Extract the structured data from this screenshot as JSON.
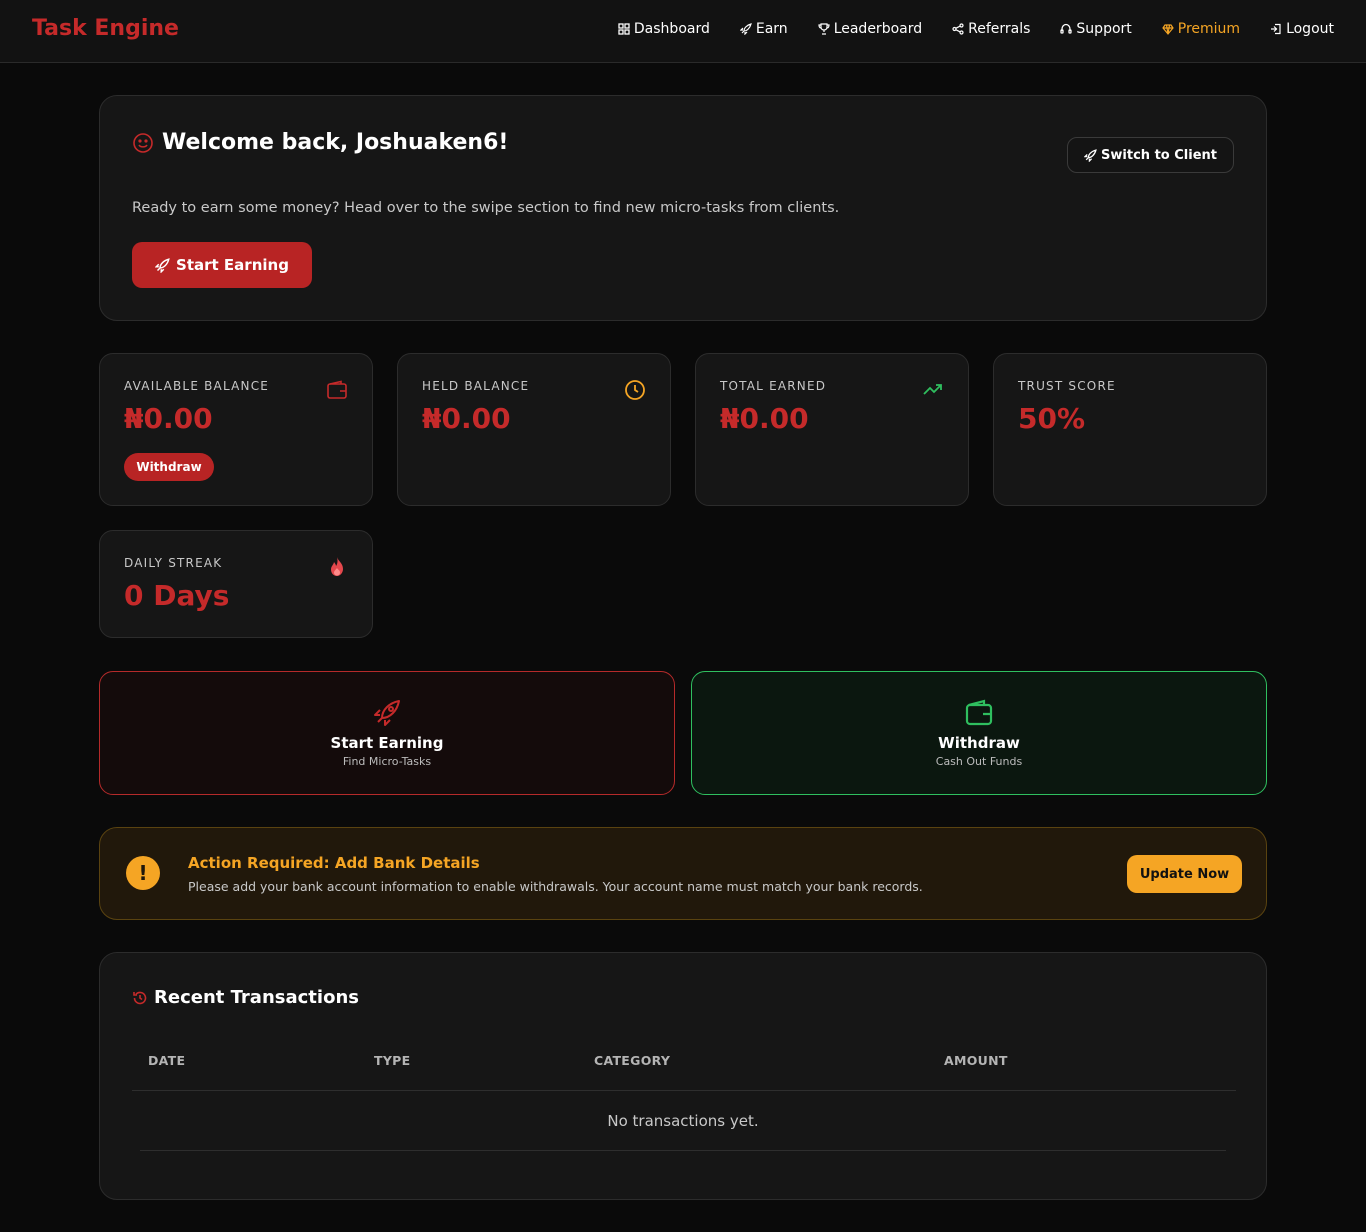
{
  "nav": {
    "brand": "Task Engine",
    "links": [
      {
        "label": "Dashboard",
        "icon": "grid-icon"
      },
      {
        "label": "Earn",
        "icon": "rocket-icon"
      },
      {
        "label": "Leaderboard",
        "icon": "trophy-icon"
      },
      {
        "label": "Referrals",
        "icon": "share-icon"
      },
      {
        "label": "Support",
        "icon": "headset-icon"
      },
      {
        "label": "Premium",
        "icon": "gem-icon",
        "color": "#f5a524"
      },
      {
        "label": "Logout",
        "icon": "logout-icon"
      }
    ]
  },
  "welcome": {
    "title": "Welcome back, Joshuaken6!",
    "switch_label": "Switch to Client",
    "description": "Ready to earn some money? Head over to the swipe section to find new micro-tasks from clients.",
    "start_label": "Start Earning"
  },
  "stats": {
    "available": {
      "label": "AVAILABLE BALANCE",
      "value": "₦0.00",
      "button": "Withdraw",
      "icon": "wallet-icon"
    },
    "held": {
      "label": "HELD BALANCE",
      "value": "₦0.00",
      "icon": "clock-icon"
    },
    "total": {
      "label": "TOTAL EARNED",
      "value": "₦0.00",
      "icon": "trending-up-icon"
    },
    "trust": {
      "label": "TRUST SCORE",
      "value": "50%"
    },
    "streak": {
      "label": "DAILY STREAK",
      "value": "0 Days",
      "icon": "fire-icon"
    }
  },
  "actions": {
    "earn": {
      "title": "Start Earning",
      "subtitle": "Find Micro-Tasks",
      "icon": "rocket-icon"
    },
    "withdraw": {
      "title": "Withdraw",
      "subtitle": "Cash Out Funds",
      "icon": "wallet-icon"
    }
  },
  "alert": {
    "title": "Action Required: Add Bank Details",
    "description": "Please add your bank account information to enable withdrawals. Your account name must match your bank records.",
    "button": "Update Now",
    "icon_text": "!"
  },
  "transactions": {
    "title": "Recent Transactions",
    "columns": [
      "DATE",
      "TYPE",
      "CATEGORY",
      "AMOUNT"
    ],
    "empty": "No transactions yet."
  },
  "colors": {
    "accent_red": "#c52a2a",
    "accent_amber": "#f5a524",
    "accent_green": "#2fbf5f"
  }
}
